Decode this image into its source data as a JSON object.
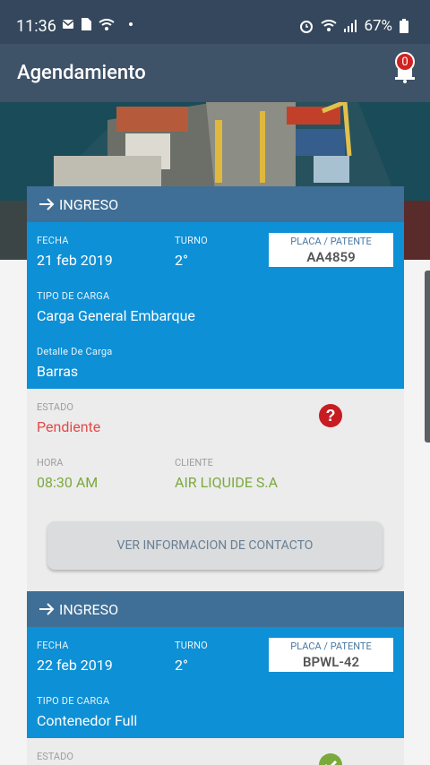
{
  "status_bar": {
    "time": "11:36",
    "battery": "67%"
  },
  "header": {
    "title": "Agendamiento",
    "notifications": "0"
  },
  "cards": [
    {
      "header": "INGRESO",
      "fecha_label": "FECHA",
      "fecha": "21 feb 2019",
      "turno_label": "TURNO",
      "turno": "2°",
      "placa_label": "PLACA / PATENTE",
      "placa": "AA4859",
      "tipo_label": "TIPO DE CARGA",
      "tipo": "Carga General Embarque",
      "detalle_label": "Detalle De Carga",
      "detalle": "Barras",
      "estado_label": "ESTADO",
      "estado": "Pendiente",
      "hora_label": "HORA",
      "hora": "08:30 AM",
      "cliente_label": "CLIENTE",
      "cliente": "AIR LIQUIDE S.A",
      "button": "VER INFORMACION DE CONTACTO"
    },
    {
      "header": "INGRESO",
      "fecha_label": "FECHA",
      "fecha": "22 feb 2019",
      "turno_label": "TURNO",
      "turno": "2°",
      "placa_label": "PLACA / PATENTE",
      "placa": "BPWL-42",
      "tipo_label": "TIPO DE CARGA",
      "tipo": "Contenedor Full",
      "estado_label": "ESTADO"
    }
  ],
  "colors": {
    "accent": "#0d90d6",
    "header": "#3e5268",
    "card_header": "#3f6f96",
    "pending": "#e04b48",
    "ok": "#7aaa3c"
  },
  "icons": [
    "mail-icon",
    "sim-icon",
    "wifi-icon",
    "alarm-icon",
    "signal-icon",
    "battery-icon",
    "bell-icon",
    "arrow-right-icon",
    "question-icon",
    "check-icon"
  ]
}
